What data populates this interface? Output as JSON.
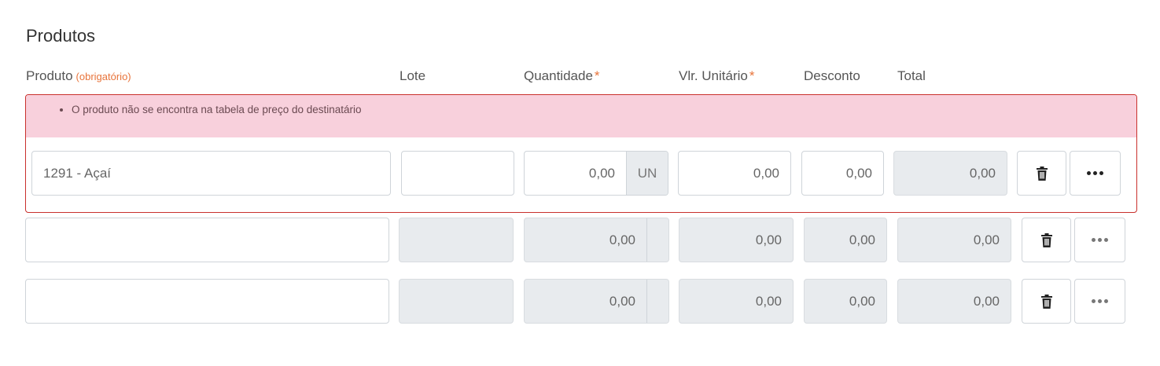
{
  "section": {
    "title": "Produtos"
  },
  "headers": {
    "produto": "Produto",
    "produto_req": "(obrigatório)",
    "lote": "Lote",
    "quantidade": "Quantidade",
    "vlr_unitario": "Vlr. Unitário",
    "required_mark": "*",
    "desconto": "Desconto",
    "total": "Total"
  },
  "error": {
    "messages": [
      "O produto não se encontra na tabela de preço do destinatário"
    ]
  },
  "rows": [
    {
      "produto": "1291 - Açaí",
      "lote": "",
      "quantidade": "0,00",
      "unidade": "UN",
      "vlr_unitario": "0,00",
      "desconto": "0,00",
      "total": "0,00"
    },
    {
      "produto": "",
      "lote": "",
      "quantidade": "0,00",
      "unidade": "",
      "vlr_unitario": "0,00",
      "desconto": "0,00",
      "total": "0,00"
    },
    {
      "produto": "",
      "lote": "",
      "quantidade": "0,00",
      "unidade": "",
      "vlr_unitario": "0,00",
      "desconto": "0,00",
      "total": "0,00"
    }
  ],
  "icons": {
    "delete": "trash-icon",
    "more": "more-options-icon"
  }
}
